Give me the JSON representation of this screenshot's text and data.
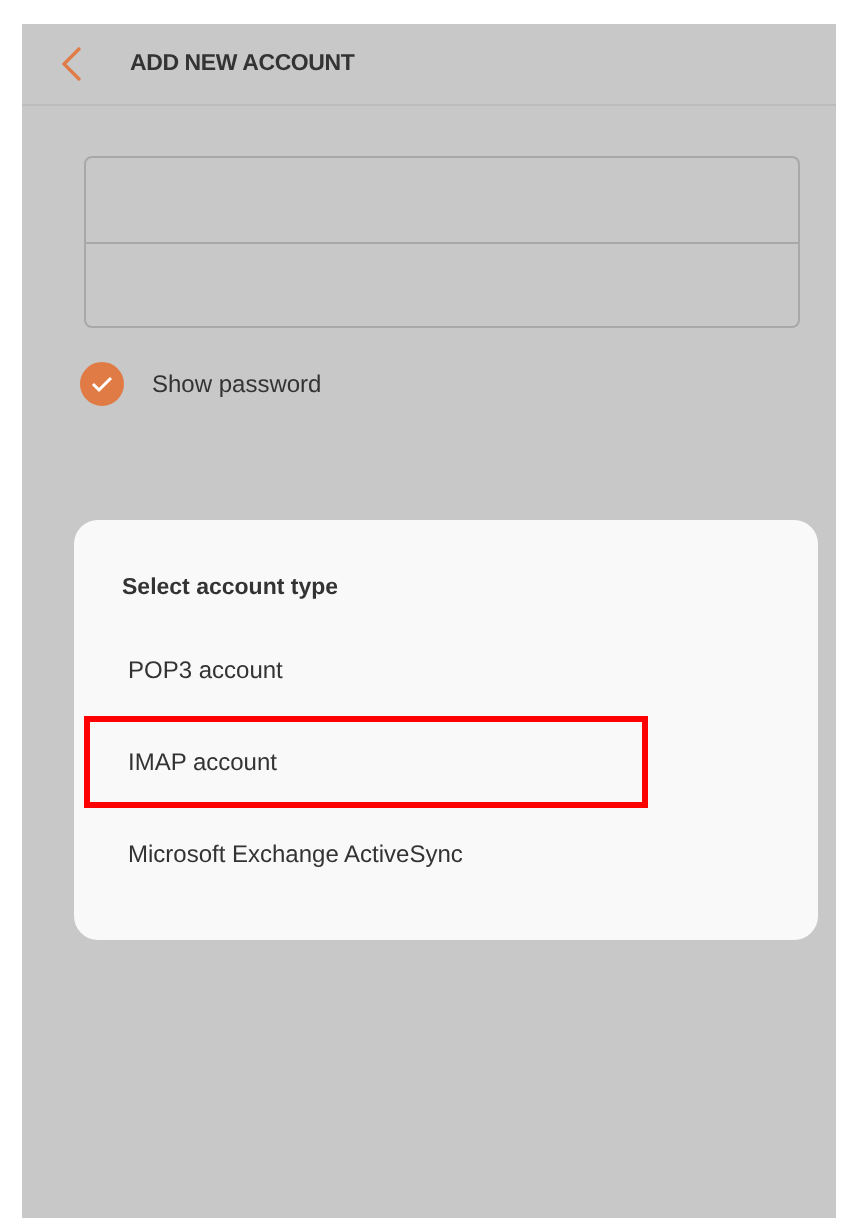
{
  "header": {
    "title": "ADD NEW ACCOUNT"
  },
  "show_password": {
    "label": "Show password",
    "checked": true
  },
  "dialog": {
    "title": "Select account type",
    "options": [
      {
        "label": "POP3 account",
        "highlighted": false
      },
      {
        "label": "IMAP account",
        "highlighted": true
      },
      {
        "label": "Microsoft Exchange ActiveSync",
        "highlighted": false
      }
    ]
  }
}
